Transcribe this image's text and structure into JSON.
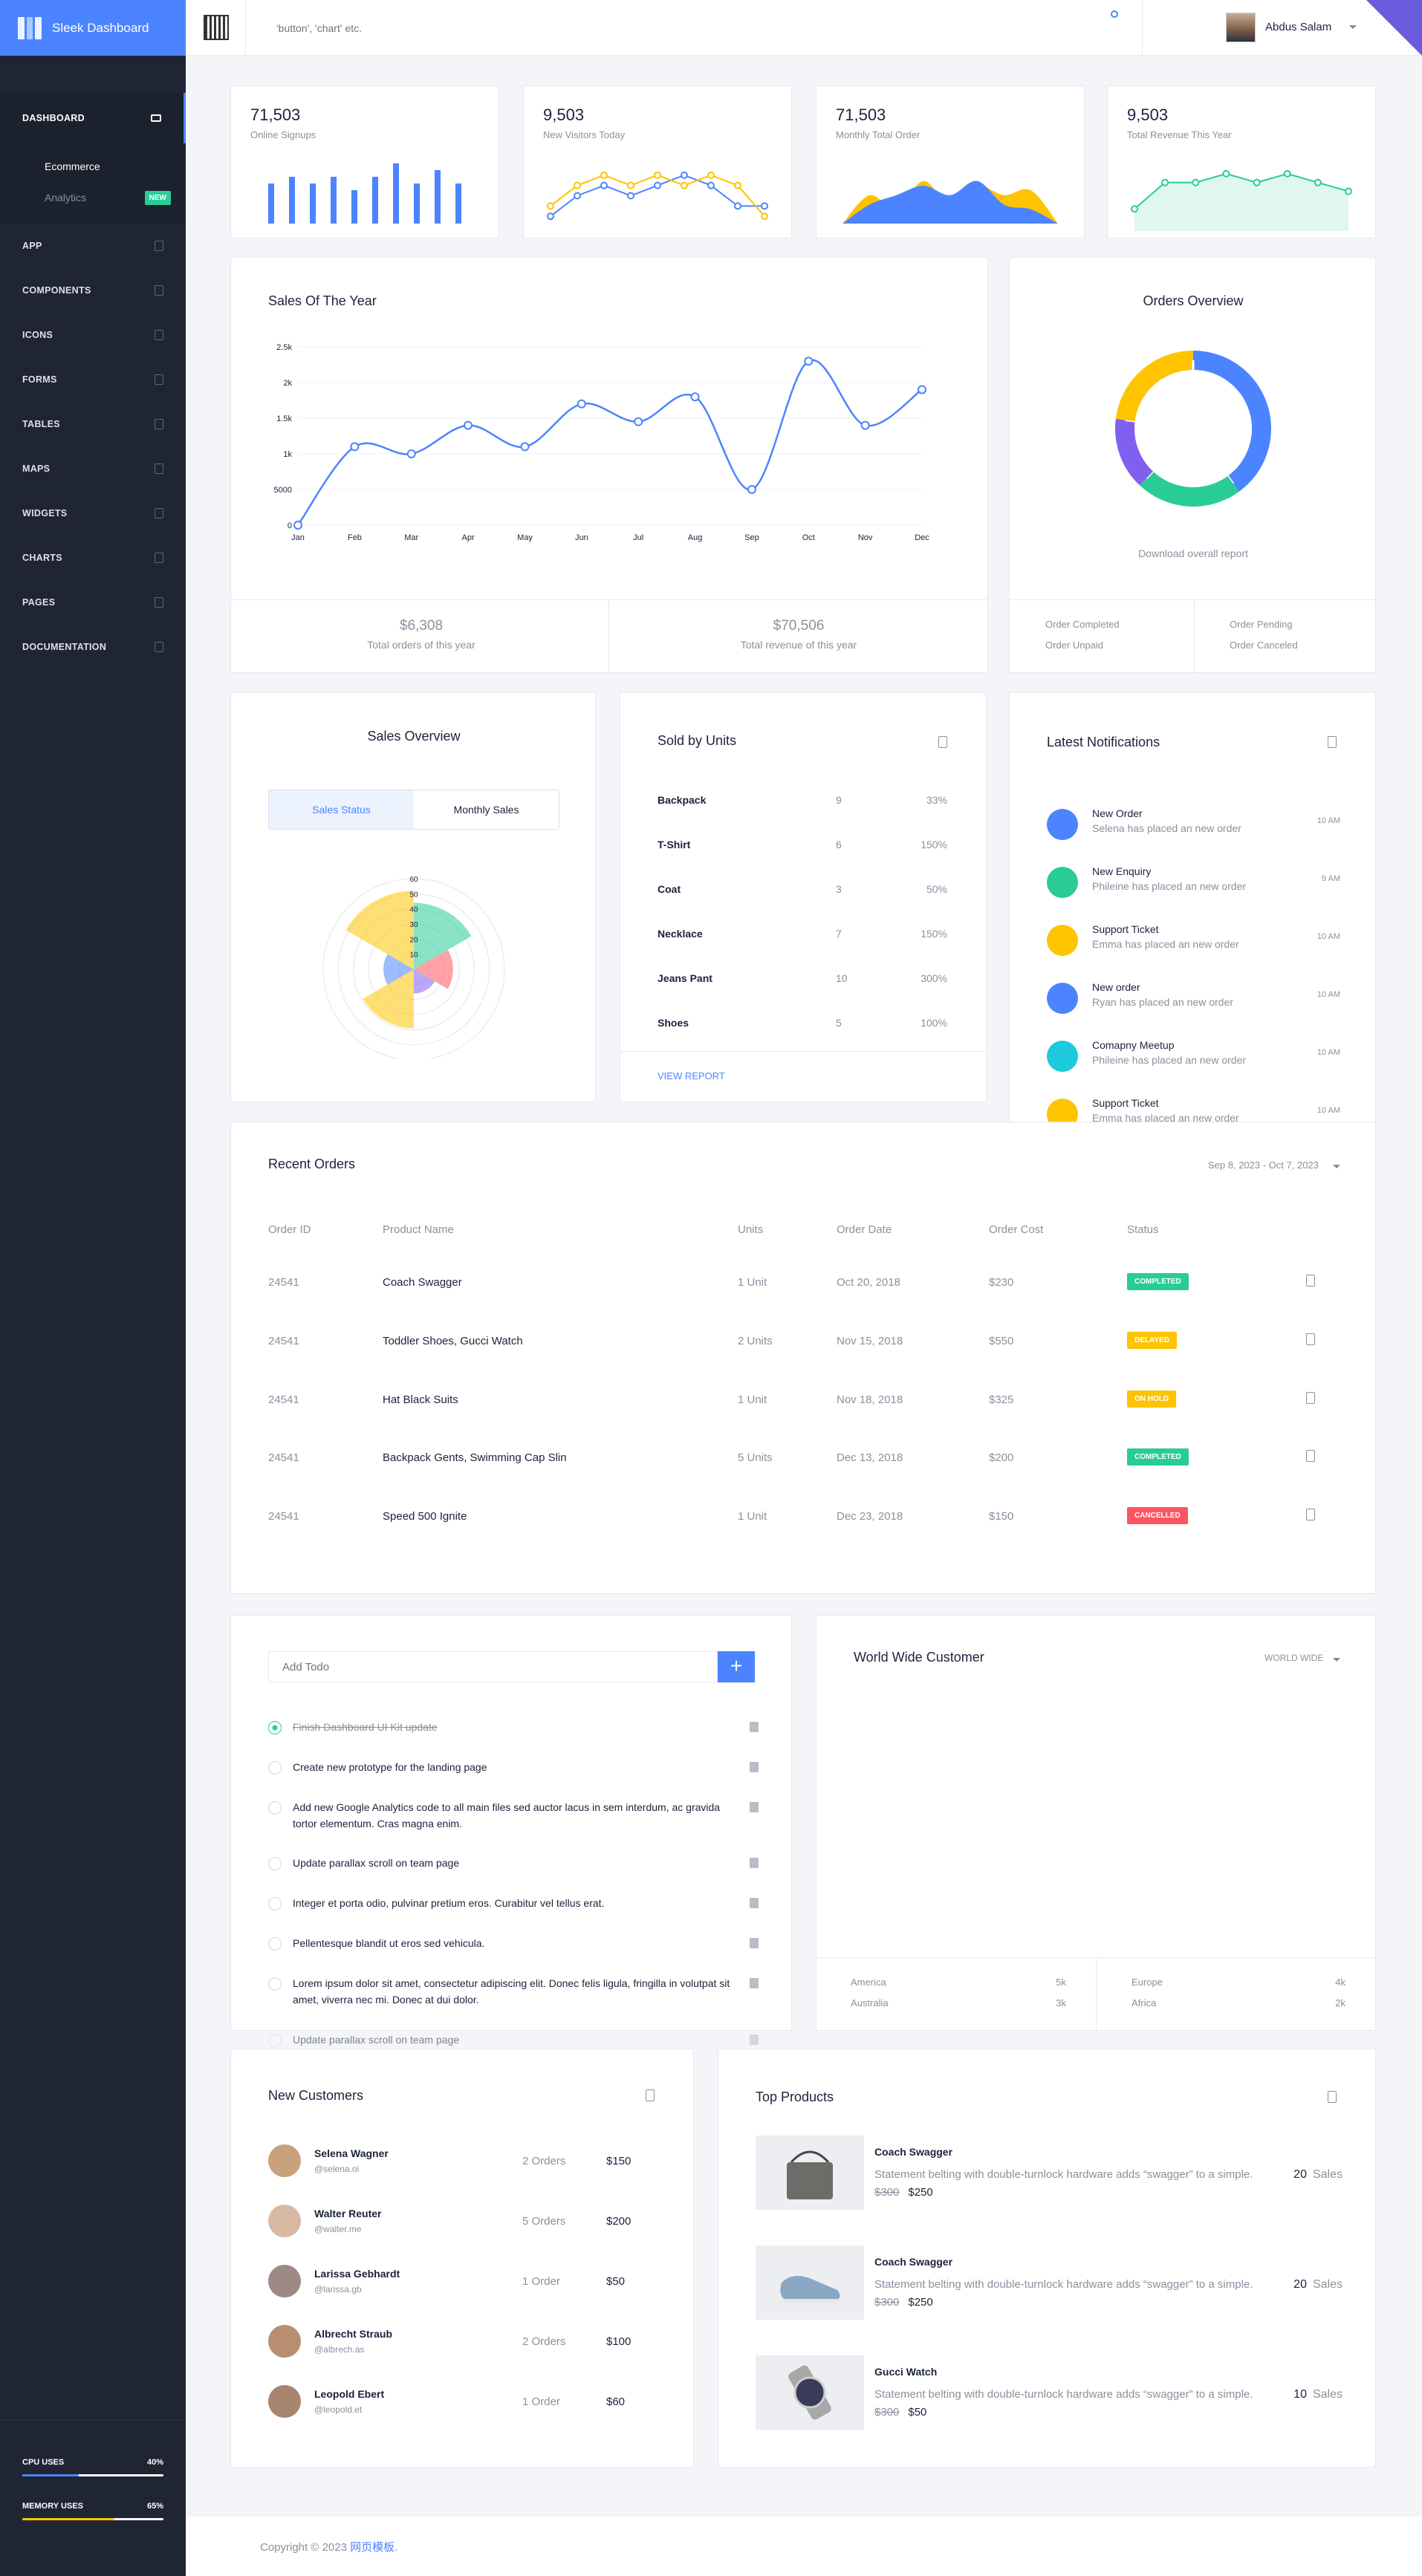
{
  "brand": {
    "name": "Sleek Dashboard"
  },
  "sidebar": {
    "items": [
      {
        "label": "DASHBOARD"
      },
      {
        "label": "APP"
      },
      {
        "label": "COMPONENTS"
      },
      {
        "label": "ICONS"
      },
      {
        "label": "FORMS"
      },
      {
        "label": "TABLES"
      },
      {
        "label": "MAPS"
      },
      {
        "label": "WIDGETS"
      },
      {
        "label": "CHARTS"
      },
      {
        "label": "PAGES"
      },
      {
        "label": "DOCUMENTATION"
      }
    ],
    "subitems": [
      {
        "label": "Ecommerce"
      },
      {
        "label": "Analytics",
        "badge": "NEW"
      }
    ],
    "cpu": {
      "label": "CPU USES",
      "value": "40%",
      "fraction": 0.4,
      "color": "#4c84ff"
    },
    "memory": {
      "label": "MEMORY USES",
      "value": "65%",
      "fraction": 0.65,
      "color": "#fec400"
    }
  },
  "topbar": {
    "search_placeholder": "'button', 'chart' etc.",
    "user_name": "Abdus Salam"
  },
  "stats": [
    {
      "value": "71,503",
      "label": "Online Signups"
    },
    {
      "value": "9,503",
      "label": "New Visitors Today"
    },
    {
      "value": "71,503",
      "label": "Monthly Total Order"
    },
    {
      "value": "9,503",
      "label": "Total Revenue This Year"
    }
  ],
  "sales_year": {
    "title": "Sales Of The Year",
    "total_orders": "$6,308",
    "total_orders_label": "Total orders of this year",
    "total_revenue": "$70,506",
    "total_revenue_label": "Total revenue of this year"
  },
  "orders_overview": {
    "title": "Orders Overview",
    "download": "Download overall report",
    "legend": [
      "Order Completed",
      "Order Unpaid",
      "Order Pending",
      "Order Canceled"
    ]
  },
  "sales_overview": {
    "title": "Sales Overview",
    "tab_active": "Sales Status",
    "tab_other": "Monthly Sales"
  },
  "sold_units": {
    "title": "Sold by Units",
    "rows": [
      {
        "name": "Backpack",
        "units": "9",
        "pct": "33%"
      },
      {
        "name": "T-Shirt",
        "units": "6",
        "pct": "150%"
      },
      {
        "name": "Coat",
        "units": "3",
        "pct": "50%"
      },
      {
        "name": "Necklace",
        "units": "7",
        "pct": "150%"
      },
      {
        "name": "Jeans Pant",
        "units": "10",
        "pct": "300%"
      },
      {
        "name": "Shoes",
        "units": "5",
        "pct": "100%"
      }
    ],
    "report": "VIEW REPORT"
  },
  "notifications": {
    "title": "Latest Notifications",
    "items": [
      {
        "title": "New Order",
        "text": "Selena has placed an new order",
        "time": "10 AM",
        "color": "#4c84ff"
      },
      {
        "title": "New Enquiry",
        "text": "Phileine has placed an new order",
        "time": "9 AM",
        "color": "#29cc97"
      },
      {
        "title": "Support Ticket",
        "text": "Emma has placed an new order",
        "time": "10 AM",
        "color": "#fec400"
      },
      {
        "title": "New order",
        "text": "Ryan has placed an new order",
        "time": "10 AM",
        "color": "#4c84ff"
      },
      {
        "title": "Comapny Meetup",
        "text": "Phileine has placed an new order",
        "time": "10 AM",
        "color": "#1dc9dc"
      },
      {
        "title": "Support Ticket",
        "text": "Emma has placed an new order",
        "time": "10 AM",
        "color": "#fec400"
      }
    ]
  },
  "recent_orders": {
    "title": "Recent Orders",
    "date_range": "Sep 8, 2023 - Oct 7, 2023",
    "headers": [
      "Order ID",
      "Product Name",
      "Units",
      "Order Date",
      "Order Cost",
      "Status"
    ],
    "rows": [
      {
        "id": "24541",
        "product": "Coach Swagger",
        "units": "1 Unit",
        "date": "Oct 20, 2018",
        "cost": "$230",
        "status": "COMPLETED",
        "color": "#29cc97"
      },
      {
        "id": "24541",
        "product": "Toddler Shoes, Gucci Watch",
        "units": "2 Units",
        "date": "Nov 15, 2018",
        "cost": "$550",
        "status": "DELAYED",
        "color": "#fec400"
      },
      {
        "id": "24541",
        "product": "Hat Black Suits",
        "units": "1 Unit",
        "date": "Nov 18, 2018",
        "cost": "$325",
        "status": "ON HOLD",
        "color": "#fec400"
      },
      {
        "id": "24541",
        "product": "Backpack Gents, Swimming Cap Slin",
        "units": "5 Units",
        "date": "Dec 13, 2018",
        "cost": "$200",
        "status": "COMPLETED",
        "color": "#29cc97"
      },
      {
        "id": "24541",
        "product": "Speed 500 Ignite",
        "units": "1 Unit",
        "date": "Dec 23, 2018",
        "cost": "$150",
        "status": "CANCELLED",
        "color": "#fe5461"
      }
    ]
  },
  "todo": {
    "placeholder": "Add Todo",
    "add": "+",
    "items": [
      {
        "text": "Finish Dashboard UI Kit update",
        "done": true
      },
      {
        "text": "Create new prototype for the landing page",
        "done": false
      },
      {
        "text": "Add new Google Analytics code to all main files sed auctor lacus in sem interdum, ac gravida tortor elementum. Cras magna enim.",
        "done": false
      },
      {
        "text": "Update parallax scroll on team page",
        "done": false
      },
      {
        "text": "Integer et porta odio, pulvinar pretium eros. Curabitur vel tellus erat.",
        "done": false
      },
      {
        "text": "Pellentesque blandit ut eros sed vehicula.",
        "done": false
      },
      {
        "text": "Lorem ipsum dolor sit amet, consectetur adipiscing elit. Donec felis ligula, fringilla in volutpat sit amet, viverra nec mi. Donec at dui dolor.",
        "done": false
      },
      {
        "text": "Update parallax scroll on team page",
        "done": false
      }
    ]
  },
  "world": {
    "title": "World Wide Customer",
    "filter": "WORLD WIDE",
    "regions": [
      {
        "name": "America",
        "value": "5k"
      },
      {
        "name": "Australia",
        "value": "3k"
      },
      {
        "name": "Europe",
        "value": "4k"
      },
      {
        "name": "Africa",
        "value": "2k"
      }
    ]
  },
  "customers": {
    "title": "New Customers",
    "rows": [
      {
        "name": "Selena Wagner",
        "handle": "@selena.oi",
        "orders": "2 Orders",
        "amount": "$150"
      },
      {
        "name": "Walter Reuter",
        "handle": "@walter.me",
        "orders": "5 Orders",
        "amount": "$200"
      },
      {
        "name": "Larissa Gebhardt",
        "handle": "@larissa.gb",
        "orders": "1 Order",
        "amount": "$50"
      },
      {
        "name": "Albrecht Straub",
        "handle": "@albrech.as",
        "orders": "2 Orders",
        "amount": "$100"
      },
      {
        "name": "Leopold Ebert",
        "handle": "@leopold.et",
        "orders": "1 Order",
        "amount": "$60"
      }
    ]
  },
  "top_products": {
    "title": "Top Products",
    "items": [
      {
        "name": "Coach Swagger",
        "desc": "Statement belting with double-turnlock hardware adds “swagger” to a simple.",
        "old": "$300",
        "price": "$250",
        "sales": "20",
        "sales_label": "Sales"
      },
      {
        "name": "Coach Swagger",
        "desc": "Statement belting with double-turnlock hardware adds “swagger” to a simple.",
        "old": "$300",
        "price": "$250",
        "sales": "20",
        "sales_label": "Sales"
      },
      {
        "name": "Gucci Watch",
        "desc": "Statement belting with double-turnlock hardware adds “swagger” to a simple.",
        "old": "$300",
        "price": "$50",
        "sales": "10",
        "sales_label": "Sales"
      }
    ]
  },
  "footer": {
    "copyright": "Copyright © 2023 ",
    "link": "网页模板."
  },
  "chart_data": [
    {
      "type": "bar",
      "values": [
        6,
        7,
        6,
        7,
        5,
        7,
        9,
        6,
        8,
        6
      ],
      "color": "#4c84ff"
    },
    {
      "type": "line",
      "series": [
        {
          "values": [
            1,
            3,
            4,
            3,
            4,
            5,
            4,
            2,
            2
          ]
        },
        {
          "values": [
            2,
            4,
            5,
            4,
            5,
            4,
            5,
            4,
            1
          ]
        }
      ],
      "colors": [
        "#4c84ff",
        "#fec400"
      ]
    },
    {
      "type": "area",
      "series": [
        {
          "values": [
            2,
            6,
            3,
            9,
            4,
            8,
            6,
            7,
            3
          ]
        },
        {
          "values": [
            1,
            4,
            6,
            8,
            6,
            9,
            4,
            3,
            1
          ]
        }
      ],
      "colors": [
        "#fec400",
        "#4c84ff"
      ]
    },
    {
      "type": "area",
      "values": [
        2,
        5,
        5,
        6,
        5,
        6,
        5,
        4
      ],
      "color": "#29cc97"
    },
    {
      "type": "line",
      "title": "Sales Of The Year",
      "categories": [
        "Jan",
        "Feb",
        "Mar",
        "Apr",
        "May",
        "Jun",
        "Jul",
        "Aug",
        "Sep",
        "Oct",
        "Nov",
        "Dec"
      ],
      "values": [
        0,
        1100,
        1000,
        1400,
        1100,
        1700,
        1450,
        1800,
        500,
        2300,
        1400,
        1900
      ],
      "y_ticks": [
        "0",
        "5000",
        "1k",
        "1.5k",
        "2k",
        "2.5k"
      ],
      "ylim": [
        0,
        2500
      ],
      "color": "#4c84ff"
    },
    {
      "type": "pie",
      "variant": "donut",
      "values": [
        40,
        22,
        15,
        23
      ],
      "colors": [
        "#4c84ff",
        "#29cc97",
        "#8061ef",
        "#fec400"
      ]
    },
    {
      "type": "pie",
      "variant": "polar-area",
      "values": [
        44,
        26,
        16,
        39,
        20,
        52
      ],
      "colors": [
        "#29cc97",
        "#fe5461",
        "#8061ef",
        "#fec400",
        "#4c84ff",
        "#fec400"
      ],
      "r_ticks": [
        "0",
        "10",
        "20",
        "30",
        "40",
        "50",
        "60"
      ],
      "rlim": [
        0,
        60
      ]
    }
  ]
}
